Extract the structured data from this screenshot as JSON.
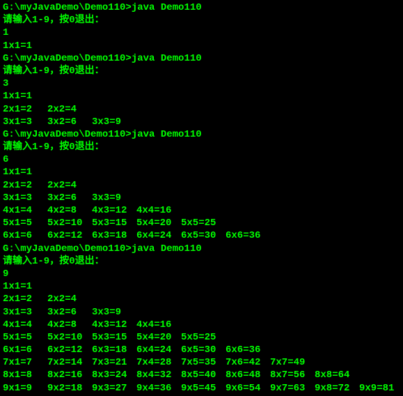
{
  "prompt_path": "G:\\myJavaDemo\\Demo110>",
  "command": "java Demo110",
  "input_prompt": "请输入1-9，按0退出：",
  "runs": [
    {
      "input": "1",
      "n": 1
    },
    {
      "input": "3",
      "n": 3
    },
    {
      "input": "6",
      "n": 6
    },
    {
      "input": "9",
      "n": 9
    }
  ]
}
